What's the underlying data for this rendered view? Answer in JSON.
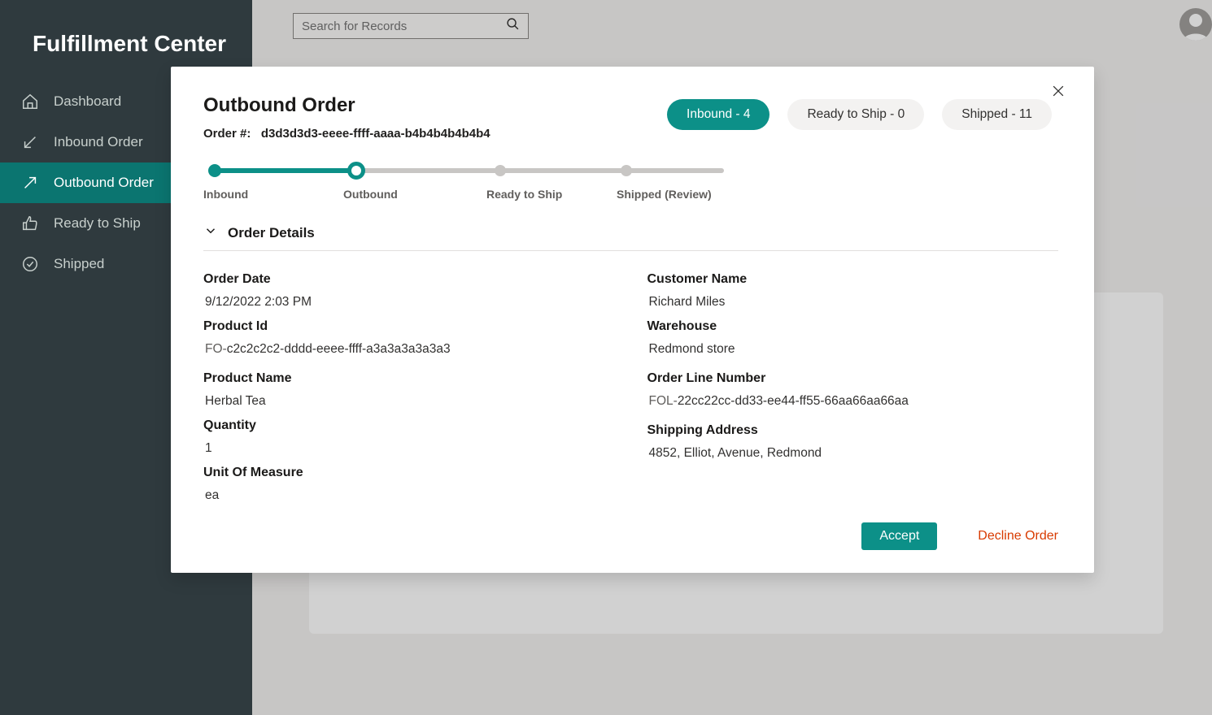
{
  "brand": "Fulfillment Center",
  "search": {
    "placeholder": "Search for Records"
  },
  "nav": [
    {
      "label": "Dashboard"
    },
    {
      "label": "Inbound Order"
    },
    {
      "label": "Outbound Order"
    },
    {
      "label": "Ready to Ship"
    },
    {
      "label": "Shipped"
    }
  ],
  "modal": {
    "title": "Outbound Order",
    "orderNumberLabel": "Order #:",
    "orderNumber": "d3d3d3d3-eeee-ffff-aaaa-b4b4b4b4b4b4",
    "chips": [
      {
        "text": "Inbound - 4"
      },
      {
        "text": "Ready to Ship - 0"
      },
      {
        "text": "Shipped - 11"
      }
    ],
    "steps": {
      "s1": "Inbound",
      "s2": "Outbound",
      "s3": "Ready to Ship",
      "s4": "Shipped (Review)"
    },
    "sectionTitle": "Order Details",
    "left": {
      "orderDateLabel": "Order Date",
      "orderDate": "9/12/2022 2:03 PM",
      "productIdLabel": "Product Id",
      "productIdPrefix": "FO-",
      "productId": "c2c2c2c2-dddd-eeee-ffff-a3a3a3a3a3a3",
      "productNameLabel": "Product Name",
      "productName": "Herbal Tea",
      "quantityLabel": "Quantity",
      "quantity": "1",
      "uomLabel": "Unit Of Measure",
      "uom": "ea"
    },
    "right": {
      "customerNameLabel": "Customer Name",
      "customerName": "Richard Miles",
      "warehouseLabel": "Warehouse",
      "warehouse": "Redmond store",
      "orderLineLabel": "Order Line Number",
      "orderLinePrefix": "FOL-",
      "orderLine": "22cc22cc-dd33-ee44-ff55-66aa66aa66aa",
      "shipAddrLabel": "Shipping Address",
      "shipAddr": "4852, Elliot, Avenue, Redmond"
    },
    "actions": {
      "accept": "Accept",
      "decline": "Decline Order"
    }
  }
}
